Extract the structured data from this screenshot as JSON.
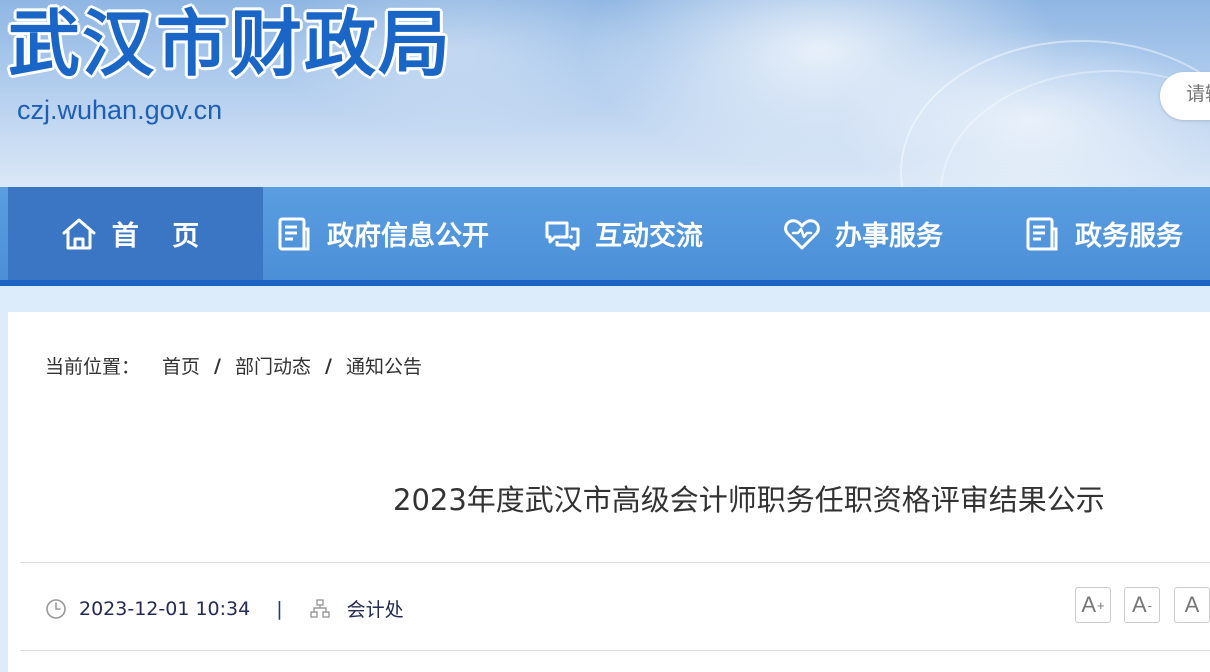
{
  "header": {
    "site_title": "武汉市财政局",
    "site_url": "czj.wuhan.gov.cn",
    "search_placeholder": "请输"
  },
  "nav": {
    "items": [
      {
        "label": "首 页",
        "icon": "home-icon",
        "active": true
      },
      {
        "label": "政府信息公开",
        "icon": "document-icon"
      },
      {
        "label": "互动交流",
        "icon": "chat-icon"
      },
      {
        "label": "办事服务",
        "icon": "heart-icon"
      },
      {
        "label": "政务服务",
        "icon": "document-icon"
      }
    ]
  },
  "breadcrumb": {
    "prefix": "当前位置：",
    "items": [
      "首页",
      "部门动态",
      "通知公告"
    ],
    "separator": "/"
  },
  "article": {
    "title": "2023年度武汉市高级会计师职务任职资格评审结果公示",
    "datetime": "2023-12-01 10:34",
    "divider": "|",
    "department": "会计处"
  },
  "font_controls": {
    "increase": "A",
    "increase_mark": "+",
    "decrease": "A",
    "decrease_mark": "-",
    "reset": "A"
  },
  "colors": {
    "nav_bg": "#4b8fd8",
    "nav_active": "#3a76c4",
    "nav_bottom": "#1d63c4",
    "logo_blue": "#1a66c6",
    "page_bg": "#dcecfa"
  }
}
